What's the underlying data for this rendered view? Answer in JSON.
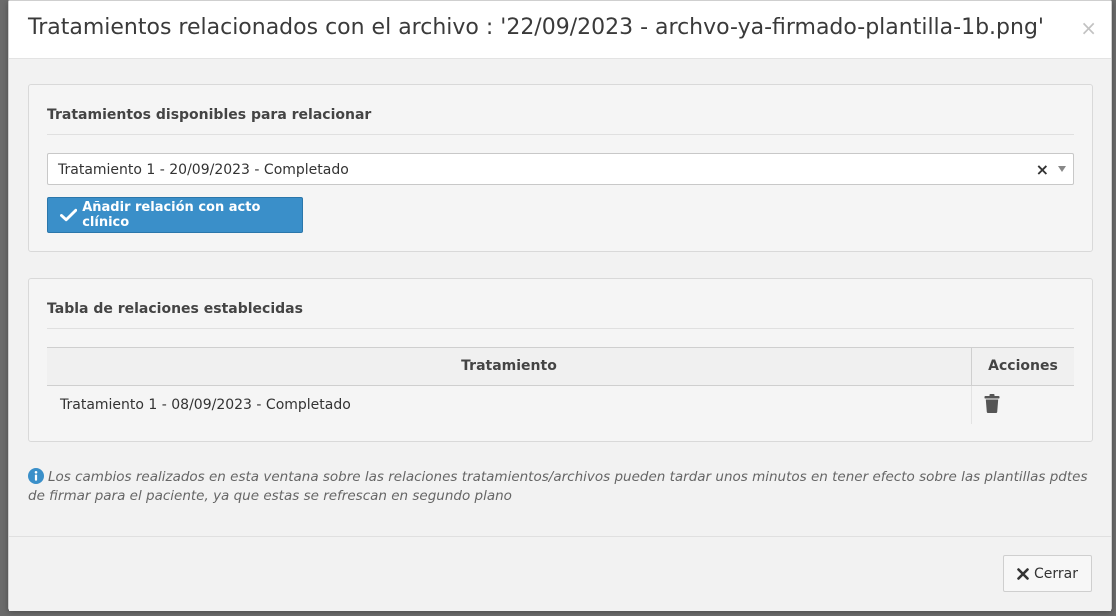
{
  "modal": {
    "title": "Tratamientos relacionados con el archivo : '22/09/2023 - archvo-ya-firmado-plantilla-1b.png'",
    "close_glyph": "×"
  },
  "available_panel": {
    "heading": "Tratamientos disponibles para relacionar",
    "select": {
      "selected_value": "Tratamiento 1 - 20/09/2023 - Completado",
      "clear_glyph": "×"
    },
    "add_button_label": "Añadir relación con acto clínico"
  },
  "relations_panel": {
    "heading": "Tabla de relaciones establecidas",
    "columns": [
      "Tratamiento",
      "Acciones"
    ],
    "rows": [
      {
        "treatment": "Tratamiento 1 - 08/09/2023 - Completado",
        "action_icon": "trash-icon"
      }
    ]
  },
  "note": {
    "icon": "info-icon",
    "text": "Los cambios realizados en esta ventana sobre las relaciones tratamientos/archivos pueden tardar unos minutos en tener efecto sobre las plantillas pdtes de firmar para el paciente, ya que estas se refrescan en segundo plano"
  },
  "footer": {
    "close_button_label": "Cerrar"
  },
  "colors": {
    "primary_button": "#3a8fc9",
    "info_icon": "#3a8fc9",
    "trash_icon": "#555555"
  }
}
